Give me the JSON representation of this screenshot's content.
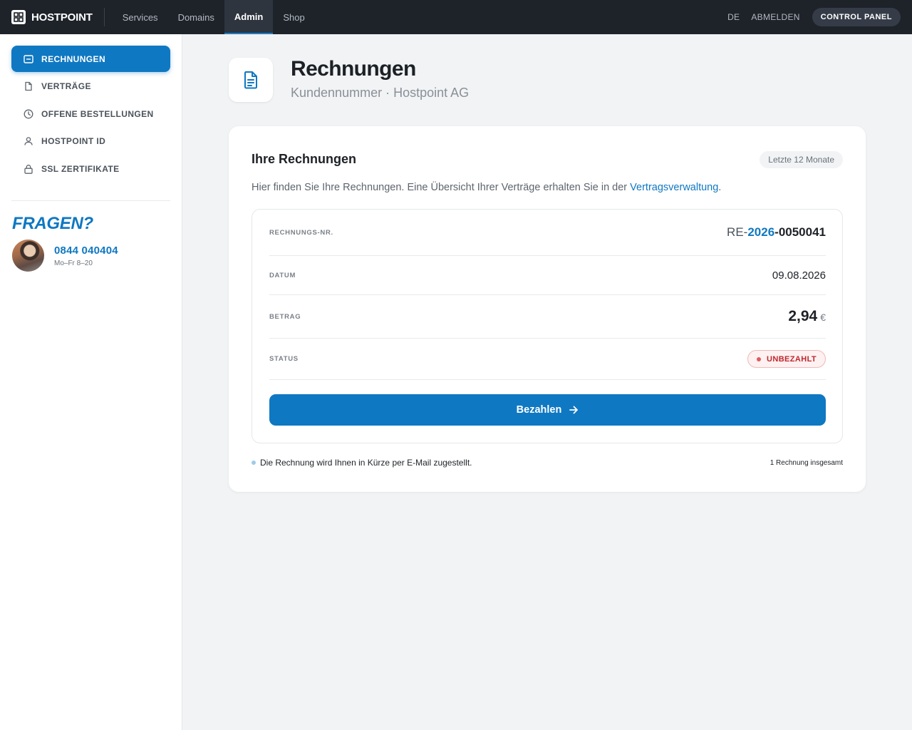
{
  "topbar": {
    "brand": "HOSTPOINT",
    "tabs": [
      {
        "label": "Services"
      },
      {
        "label": "Domains"
      },
      {
        "label": "Admin"
      },
      {
        "label": "Shop"
      }
    ],
    "language": "DE",
    "logout": "ABMELDEN",
    "control_panel": "CONTROL PANEL"
  },
  "sidebar": {
    "items": [
      {
        "label": "RECHNUNGEN",
        "icon": "invoice-icon"
      },
      {
        "label": "VERTRÄGE",
        "icon": "document-icon"
      },
      {
        "label": "OFFENE BESTELLUNGEN",
        "icon": "clock-icon"
      },
      {
        "label": "HOSTPOINT ID",
        "icon": "user-icon"
      },
      {
        "label": "SSL ZERTIFIKATE",
        "icon": "lock-icon"
      }
    ],
    "faq_title": "FRAGEN?",
    "phone": "0844 040404",
    "hours": "Mo–Fr 8–20"
  },
  "header": {
    "title": "Rechnungen",
    "subtitle": "Kundennummer · Hostpoint AG"
  },
  "card": {
    "title": "Ihre Rechnungen",
    "range": "Letzte 12 Monate",
    "desc_text": "Hier finden Sie Ihre Rechnungen. Eine Übersicht Ihrer Verträge erhalten Sie in der ",
    "desc_link": "Vertragsverwaltung",
    "desc_end": ".",
    "invoice": {
      "nr_label": "RECHNUNGS-NR.",
      "nr_prefix": "RE-",
      "nr_year": "2026",
      "nr_suffix": "-0050041",
      "date_label": "DATUM",
      "date": "09.08.2026",
      "amount_label": "BETRAG",
      "amount": "2,94",
      "currency": "€",
      "status_label": "STATUS",
      "status": "UNBEZAHLT"
    },
    "pay_button": "Bezahlen",
    "footnote": "Die Rechnung wird Ihnen in Kürze per E-Mail zugestellt.",
    "count": "1 Rechnung insgesamt"
  },
  "colors": {
    "accent": "#0f78c2",
    "topbar": "#1e232a",
    "status_unpaid": "#c0262d"
  }
}
